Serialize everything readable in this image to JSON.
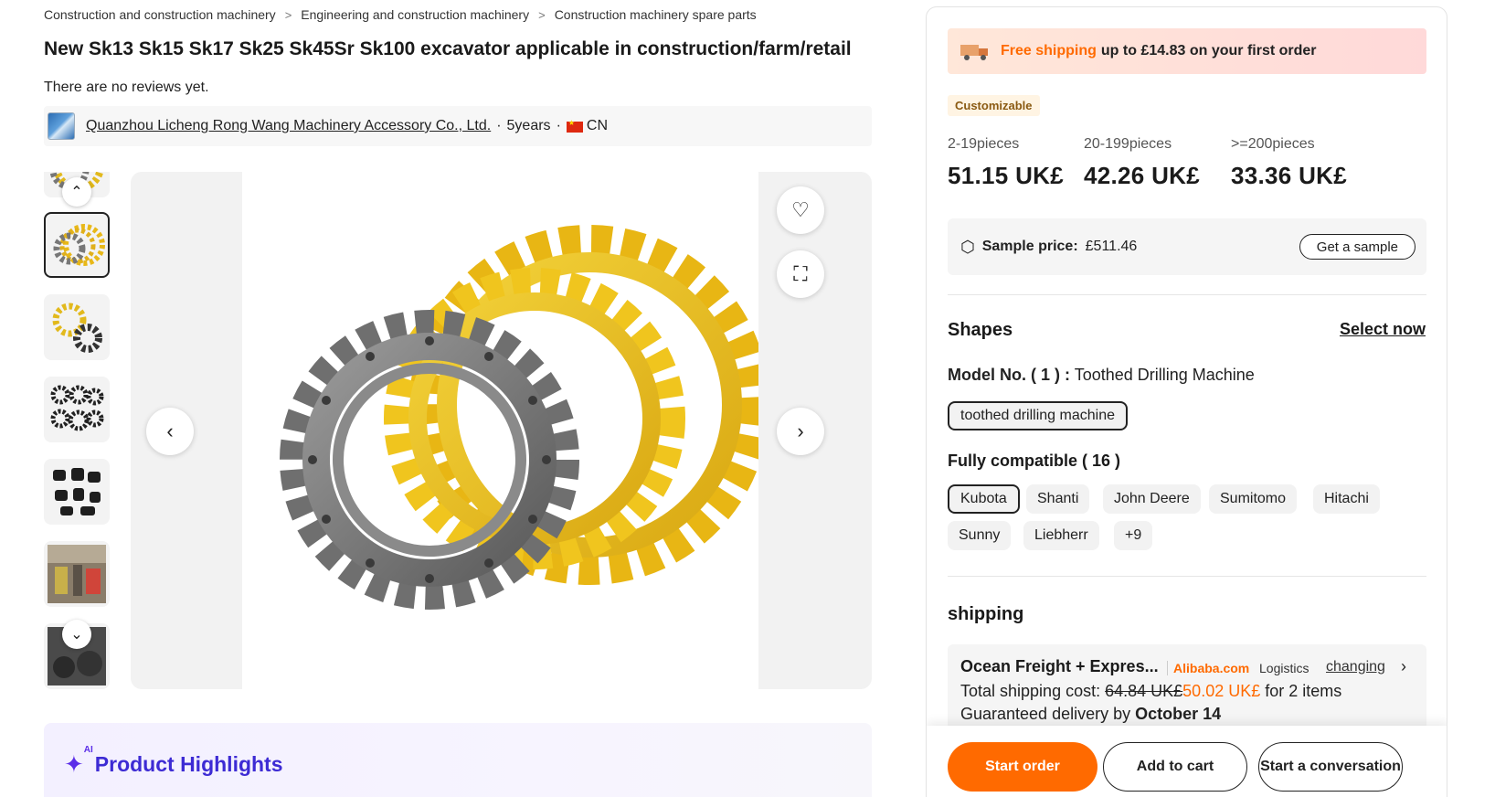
{
  "breadcrumb": [
    "Construction and construction machinery",
    "Engineering and construction machinery",
    "Construction machinery spare parts"
  ],
  "product": {
    "title": "New Sk13 Sk15 Sk17 Sk25 Sk45Sr Sk100 excavator applicable in construction/farm/retail",
    "reviews": "There are no reviews yet."
  },
  "supplier": {
    "name": "Quanzhou Licheng Rong Wang Machinery Accessory Co., Ltd.",
    "years": "5years",
    "country": "CN",
    "separator": "·"
  },
  "gallery": {
    "thumbnails": [
      "sprocket-set-thumbnail",
      "gears-thumbnail",
      "rollers-thumbnail",
      "track-parts-thumbnail",
      "warehouse-thumbnail",
      "parts-pile-thumbnail"
    ],
    "selected_index": 1
  },
  "highlights": {
    "title": "Product Highlights",
    "badge": "AI"
  },
  "promo": {
    "highlight": "Free shipping",
    "text": "up to £14.83 on your first order"
  },
  "customizable": "Customizable",
  "pricing": [
    {
      "qty": "2-19pieces",
      "price": "51.15 UK£"
    },
    {
      "qty": "20-199pieces",
      "price": "42.26 UK£"
    },
    {
      "qty": ">=200pieces",
      "price": "33.36 UK£"
    }
  ],
  "sample": {
    "label": "Sample price:",
    "price": "£511.46",
    "button": "Get a sample"
  },
  "shapes": {
    "title": "Shapes",
    "select_now": "Select now",
    "model_label": "Model No. ( 1 ) :",
    "model_value": "Toothed Drilling Machine",
    "model_option": "toothed drilling machine"
  },
  "compatible": {
    "title": "Fully compatible ( 16 )",
    "options": [
      "Kubota",
      "Shanti",
      "John Deere",
      "Sumitomo",
      "Hitachi",
      "Sunny",
      "Liebherr",
      "+9"
    ]
  },
  "shipping": {
    "title": "shipping",
    "method": "Ocean Freight + Expres...",
    "brand": "Alibaba.com",
    "logistics": "Logistics",
    "change": "changing",
    "cost_label": "Total shipping cost:",
    "old_cost": "64.84 UK£",
    "new_cost": "50.02 UK£",
    "cost_suffix": "for 2 items",
    "delivery_label": "Guaranteed delivery by",
    "delivery_date": "October 14"
  },
  "actions": {
    "start_order": "Start order",
    "add_to_cart": "Add to cart",
    "conversation": "Start a conversation"
  },
  "colors": {
    "accent": "#ff6a00",
    "highlight": "#3d2bd4"
  }
}
